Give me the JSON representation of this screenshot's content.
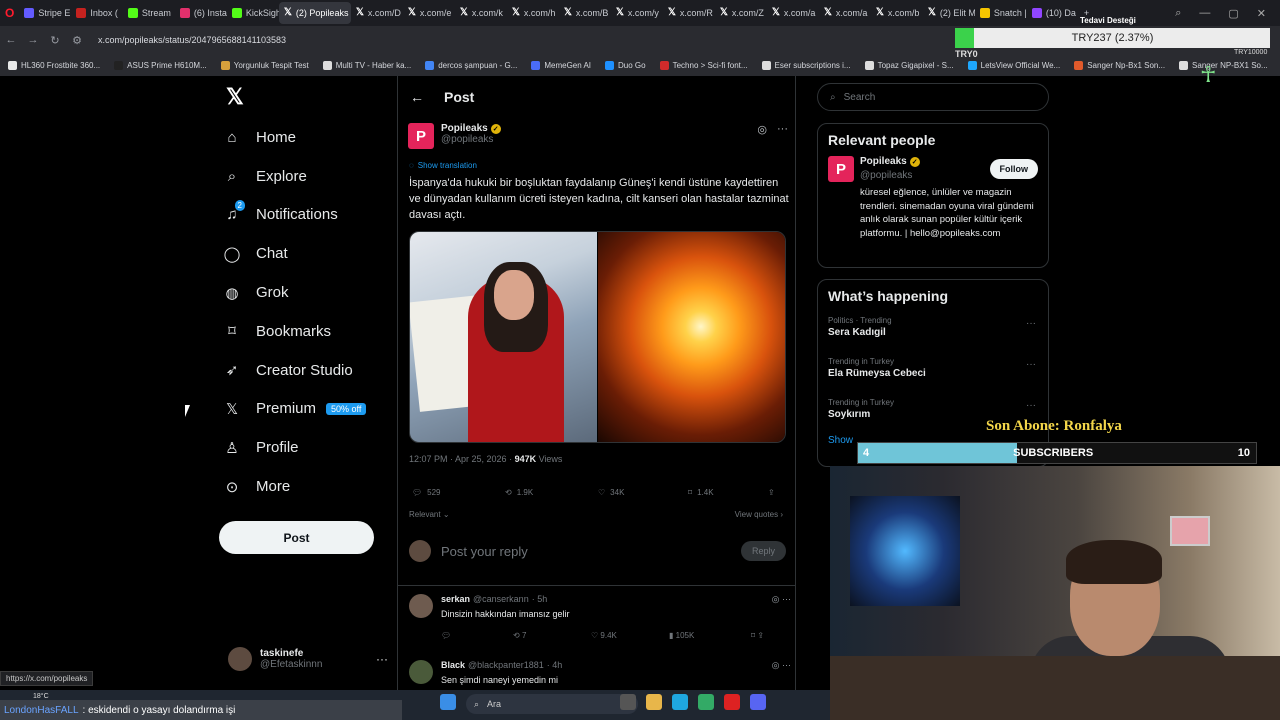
{
  "browser": {
    "tabs": [
      {
        "label": "Stripe E",
        "color": "#635bff"
      },
      {
        "label": "Inbox (",
        "color": "#c5221f"
      },
      {
        "label": "Stream",
        "color": "#53fc18"
      },
      {
        "label": "(6) Insta",
        "color": "#e1306c"
      },
      {
        "label": "KickSigh",
        "color": "#53fc18"
      },
      {
        "label": "(2) Popileaks o",
        "color": "#000000",
        "active": true
      },
      {
        "label": "x.com/D",
        "color": "#000000"
      },
      {
        "label": "x.com/e",
        "color": "#000000"
      },
      {
        "label": "x.com/k",
        "color": "#000000"
      },
      {
        "label": "x.com/h",
        "color": "#000000"
      },
      {
        "label": "x.com/B",
        "color": "#000000"
      },
      {
        "label": "x.com/y",
        "color": "#000000"
      },
      {
        "label": "x.com/R",
        "color": "#000000"
      },
      {
        "label": "x.com/Z",
        "color": "#000000"
      },
      {
        "label": "x.com/a",
        "color": "#000000"
      },
      {
        "label": "x.com/a",
        "color": "#000000"
      },
      {
        "label": "x.com/b",
        "color": "#000000"
      },
      {
        "label": "(2) Elit M",
        "color": "#000000"
      },
      {
        "label": "Snatch |",
        "color": "#f5c400"
      },
      {
        "label": "(10) Da",
        "color": "#9146ff"
      }
    ],
    "url": "x.com/popileaks/status/2047965688141103583",
    "bookmarks": [
      {
        "label": "HL360 Frostbite 360...",
        "color": "#e8e8e8"
      },
      {
        "label": "ASUS Prime H610M...",
        "color": "#222"
      },
      {
        "label": "Yorgunluk Tespit Test",
        "color": "#d6a03c"
      },
      {
        "label": "Multi TV - Haber ka...",
        "color": "#ddd"
      },
      {
        "label": "dercos şampuan - G...",
        "color": "#4285f4"
      },
      {
        "label": "MemeGen AI",
        "color": "#4a6cf7"
      },
      {
        "label": "Duo Go",
        "color": "#1e90ff"
      },
      {
        "label": "Techno > Sci-fi font...",
        "color": "#d12b2b"
      },
      {
        "label": "Eser subscriptions i...",
        "color": "#ddd"
      },
      {
        "label": "Topaz Gigapixel - S...",
        "color": "#ddd"
      },
      {
        "label": "LetsView Official We...",
        "color": "#1ea7fd"
      },
      {
        "label": "Sanger Np-Bx1 Son...",
        "color": "#e05a2b"
      },
      {
        "label": "Sanger NP-BX1 So...",
        "color": "#ddd"
      }
    ],
    "status_url": "https://x.com/popileaks"
  },
  "nav": {
    "items": [
      {
        "label": "Home",
        "icon": "home-icon"
      },
      {
        "label": "Explore",
        "icon": "search-icon"
      },
      {
        "label": "Notifications",
        "icon": "bell-icon",
        "badge": "2"
      },
      {
        "label": "Chat",
        "icon": "chat-icon"
      },
      {
        "label": "Grok",
        "icon": "grok-icon"
      },
      {
        "label": "Bookmarks",
        "icon": "bookmark-icon"
      },
      {
        "label": "Creator Studio",
        "icon": "rocket-icon"
      },
      {
        "label": "Premium",
        "icon": "x-icon",
        "tag": "50% off"
      },
      {
        "label": "Profile",
        "icon": "person-icon"
      },
      {
        "label": "More",
        "icon": "more-circle-icon"
      }
    ],
    "post_button": "Post",
    "me": {
      "name": "taskinefe",
      "handle": "@Efetaskinnn"
    }
  },
  "post": {
    "header": "Post",
    "author": {
      "name": "Popileaks",
      "handle": "@popileaks",
      "avatar_letter": "P"
    },
    "show_translation": "Show translation",
    "text": "İspanya'da hukuki bir boşluktan faydalanıp Güneş'i kendi üstüne kaydettiren ve dünyadan kullanım ücreti isteyen kadına, cilt kanseri olan hastalar tazminat davası açtı.",
    "time": "12:07 PM · Apr 25, 2026 · ",
    "views_count": "947K",
    "views_label": " Views",
    "replies": "529",
    "reposts": "1.9K",
    "likes": "34K",
    "bookmarks": "1.4K",
    "sort": "Relevant",
    "view_quotes": "View quotes",
    "reply_placeholder": "Post your reply",
    "reply_button": "Reply"
  },
  "comments": [
    {
      "name": "serkan",
      "handle": "@canserkann",
      "time": "· 5h",
      "text": "Dinsizin hakkından imansız gelir",
      "replies": "",
      "reposts": "7",
      "likes": "9.4K",
      "views": "105K"
    },
    {
      "name": "Black",
      "handle": "@blackpanter1881",
      "time": "· 4h",
      "text": "Sen şimdi naneyi yemedin mi"
    }
  ],
  "sidebar": {
    "search_placeholder": "Search",
    "relevant_title": "Relevant people",
    "person": {
      "name": "Popileaks",
      "handle": "@popileaks",
      "follow": "Follow",
      "bio": "küresel eğlence, ünlüler ve magazin trendleri. sinemadan oyuna viral gündemi anlık olarak sunan popüler kültür içerik platformu. | hello@popileaks.com"
    },
    "happening_title": "What’s happening",
    "trends": [
      {
        "category": "Politics · Trending",
        "name": "Sera Kadıgil"
      },
      {
        "category": "Trending in Turkey",
        "name": "Ela Rümeysa Cebeci"
      },
      {
        "category": "Trending in Turkey",
        "name": "Soykırım"
      }
    ],
    "show_more": "Show"
  },
  "overlay": {
    "ticker_title": "Tedavi Desteği",
    "ticker_value": "TRY237 (2.37%)",
    "ticker_left": "TRY0",
    "ticker_right": "TRY10000",
    "ticker_progress": 0.0237,
    "last_sub": "Son Abone: Ronfalya",
    "sub_current": "4",
    "sub_label": "SUBSCRIBERS",
    "sub_goal": "10",
    "sub_progress": 0.4,
    "chat_user": "LondonHasFALL",
    "chat_text": ": eskidendi o yasayı dolandırma işi",
    "weather": "18°C",
    "taskbar_search": "Ara"
  }
}
